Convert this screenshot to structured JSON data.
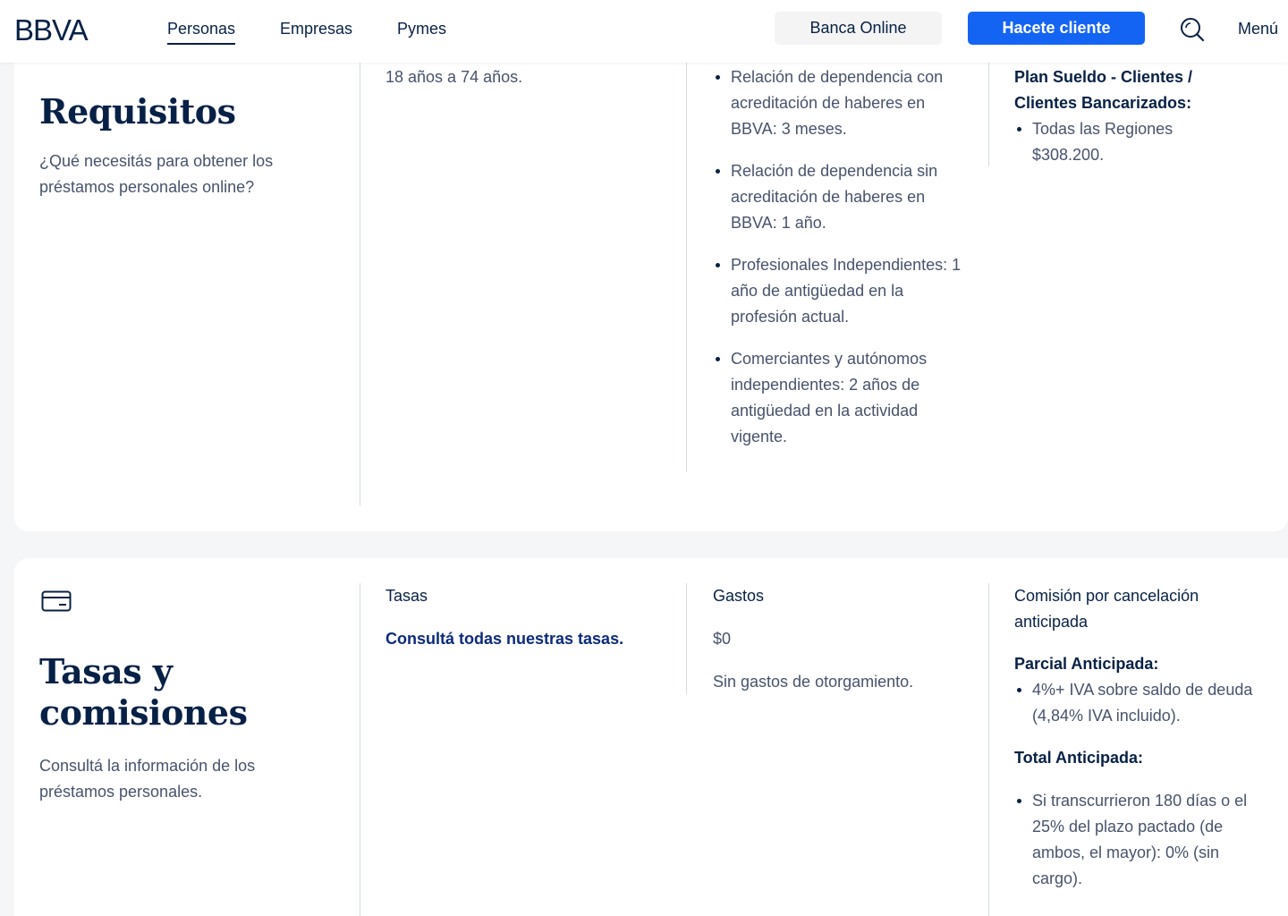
{
  "header": {
    "logo_text": "BBVA",
    "nav": [
      "Personas",
      "Empresas",
      "Pymes"
    ],
    "banca_online": "Banca Online",
    "hacete_cliente": "Hacete cliente",
    "menu": "Menú"
  },
  "requisitos": {
    "title": "Requisitos",
    "description": "¿Qué necesitás para obtener los préstamos personales online?",
    "edad_text": "18 años a 74 años.",
    "antiguedad": [
      "Relación de dependencia con acreditación de haberes en BBVA: 3 meses.",
      "Relación de dependencia sin acreditación de haberes en BBVA: 1 año.",
      "Profesionales Independientes: 1 año de antigüedad en la profesión actual.",
      "Comerciantes y autónomos independientes: 2 años de antigüedad en la actividad vigente."
    ],
    "ingresos_label": "Plan Sueldo -  Clientes / Clientes Bancarizados:",
    "ingresos_items": [
      "Todas las Regiones $308.200."
    ]
  },
  "tasas": {
    "title": "Tasas y comisiones",
    "description": "Consultá la información de los préstamos personales.",
    "tasas_label": "Tasas",
    "tasas_link": "Consultá todas nuestras tasas.",
    "gastos_label": "Gastos",
    "gastos_value": "$0",
    "gastos_note": "Sin gastos de otorgamiento.",
    "comision_label": "Comisión por cancelación anticipada",
    "parcial_label": "Parcial Anticipada:",
    "parcial_items": [
      "4%+ IVA sobre saldo de deuda (4,84% IVA incluido)."
    ],
    "total_label": "Total Anticipada:",
    "total_items": [
      "Si transcurrieron 180 días o el 25% del plazo pactado (de ambos, el mayor): 0% (sin cargo)."
    ]
  },
  "colors": {
    "brand_navy": "#072146",
    "primary_blue": "#1464f4",
    "link_blue": "#0c2a7e"
  }
}
